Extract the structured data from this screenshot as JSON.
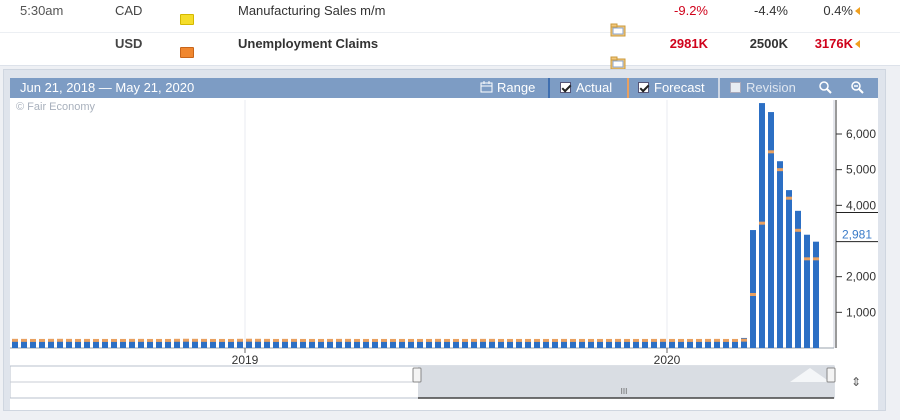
{
  "calendar": {
    "rows": [
      {
        "time": "5:30am",
        "currency": "CAD",
        "impact_color": "#f5dd2a",
        "event": "Manufacturing Sales m/m",
        "actual": "-9.2%",
        "forecast": "-4.4%",
        "previous": "0.4%",
        "bold": false,
        "actual_color": "#d0021b"
      },
      {
        "time": "",
        "currency": "USD",
        "impact_color": "#f0872f",
        "event": "Unemployment Claims",
        "actual": "2981K",
        "forecast": "2500K",
        "previous": "3176K",
        "bold": true,
        "actual_color": "#d0021b"
      }
    ]
  },
  "toolbar": {
    "date_range": "Jun 21, 2018 — May 21, 2020",
    "range_label": "Range",
    "actual_label": "Actual",
    "forecast_label": "Forecast",
    "revision_label": "Revision"
  },
  "copyright": "© Fair Economy",
  "colors": {
    "actual_bar": "#2c6fc4",
    "forecast_mark": "#e8a060",
    "axis": "#333333",
    "last_value": "#3a7bc8"
  },
  "chart_data": {
    "type": "bar",
    "x_tick_labels": [
      "2019",
      "2020"
    ],
    "y_tick_labels": [
      "1,000",
      "2,000",
      "4,000",
      "5,000",
      "6,000"
    ],
    "ylim": [
      0,
      7000
    ],
    "last_value_label": "2,981",
    "series": [
      {
        "name": "Actual",
        "values": [
          210,
          215,
          212,
          208,
          220,
          218,
          210,
          215,
          210,
          212,
          214,
          212,
          210,
          216,
          215,
          212,
          210,
          214,
          222,
          225,
          218,
          215,
          212,
          210,
          215,
          222,
          225,
          220,
          215,
          212,
          218,
          214,
          212,
          210,
          212,
          215,
          218,
          214,
          212,
          210,
          215,
          212,
          210,
          215,
          212,
          210,
          212,
          216,
          212,
          210,
          212,
          215,
          218,
          216,
          212,
          208,
          212,
          215,
          212,
          208,
          212,
          215,
          212,
          210,
          208,
          212,
          210,
          215,
          212,
          210,
          212,
          215,
          218,
          210,
          212,
          208,
          212,
          215,
          218,
          212,
          210,
          282,
          3307,
          6867,
          6615,
          5237,
          4427,
          3846,
          3176,
          2981
        ]
      },
      {
        "name": "Forecast",
        "values": [
          215,
          214,
          212,
          212,
          215,
          216,
          214,
          212,
          213,
          212,
          212,
          212,
          212,
          214,
          214,
          212,
          212,
          212,
          216,
          218,
          216,
          214,
          212,
          212,
          212,
          216,
          218,
          216,
          214,
          212,
          214,
          214,
          212,
          212,
          212,
          213,
          214,
          214,
          212,
          212,
          212,
          212,
          212,
          212,
          212,
          212,
          212,
          214,
          212,
          212,
          212,
          213,
          214,
          214,
          212,
          212,
          212,
          212,
          212,
          212,
          212,
          213,
          212,
          212,
          212,
          212,
          212,
          213,
          212,
          212,
          212,
          213,
          214,
          212,
          212,
          212,
          212,
          213,
          214,
          212,
          212,
          220,
          1500,
          3500,
          5500,
          5000,
          4200,
          3300,
          2500,
          2500
        ]
      }
    ]
  }
}
